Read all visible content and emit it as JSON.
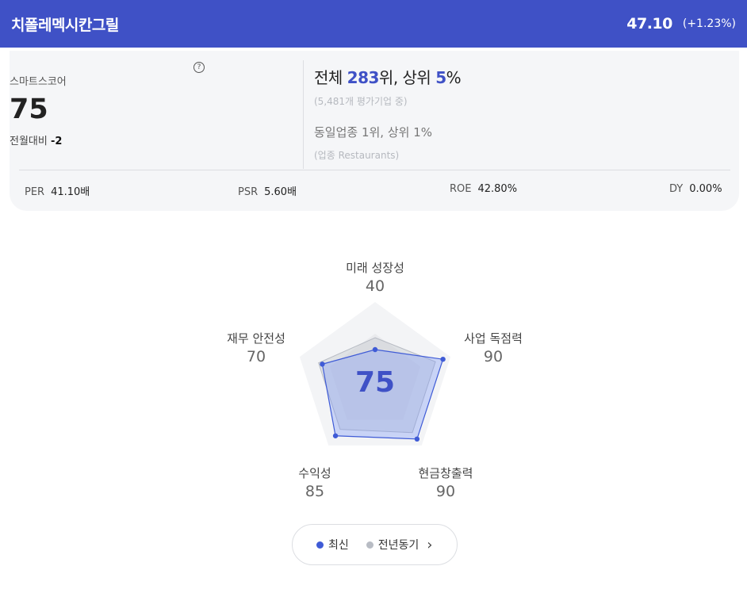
{
  "header": {
    "company": "치폴레멕시칸그릴",
    "price": "47.10",
    "change": "(+1.23%)"
  },
  "summary": {
    "score_label": "스마트스코어",
    "help_icon": "?",
    "score": "75",
    "delta_label": "전월대비",
    "delta_value": "-2",
    "rank_prefix": "전체 ",
    "rank_value": "283",
    "rank_mid": "위, 상위 ",
    "rank_pct": "5",
    "rank_suffix": "%",
    "rank_sub": "(5,481개 평가기업 중)",
    "industry_rank": "동일업종 1위, 상위 1%",
    "industry_sub": "(업종 Restaurants)"
  },
  "metrics": [
    {
      "label": "PER",
      "value": "41.10배"
    },
    {
      "label": "PSR",
      "value": "5.60배"
    },
    {
      "label": "ROE",
      "value": "42.80%"
    },
    {
      "label": "DY",
      "value": "0.00%"
    }
  ],
  "chart_data": {
    "type": "radar",
    "center_label": "75",
    "max": 100,
    "axes": [
      "미래 성장성",
      "사업 독점력",
      "현금창출력",
      "수익성",
      "재무 안전성"
    ],
    "series": [
      {
        "name": "최신",
        "values": [
          40,
          90,
          90,
          85,
          70
        ],
        "color": "#3f5bd6"
      },
      {
        "name": "전년동기",
        "values": [
          55,
          80,
          80,
          75,
          75
        ],
        "color": "#b8bcc4"
      }
    ],
    "value_labels": [
      "40",
      "90",
      "90",
      "85",
      "70"
    ]
  },
  "legend": {
    "latest": "최신",
    "prior": "전년동기",
    "latest_color": "#3f5bd6",
    "prior_color": "#b8bcc4",
    "chevron": "›"
  }
}
